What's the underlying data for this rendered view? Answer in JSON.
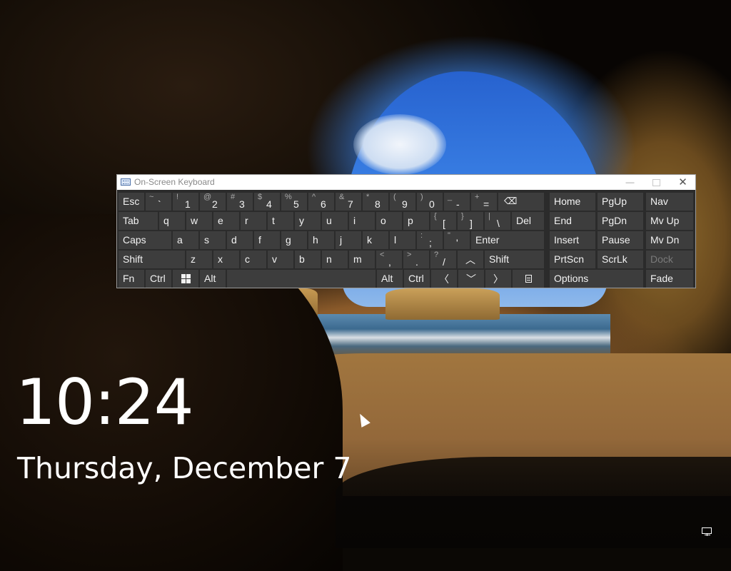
{
  "window": {
    "title": "On-Screen Keyboard",
    "minimize_glyph": "—",
    "close_glyph": "✕"
  },
  "keys": {
    "esc": "Esc",
    "grave": {
      "shift": "~",
      "main": "`"
    },
    "d1": {
      "shift": "!",
      "main": "1"
    },
    "d2": {
      "shift": "@",
      "main": "2"
    },
    "d3": {
      "shift": "#",
      "main": "3"
    },
    "d4": {
      "shift": "$",
      "main": "4"
    },
    "d5": {
      "shift": "%",
      "main": "5"
    },
    "d6": {
      "shift": "^",
      "main": "6"
    },
    "d7": {
      "shift": "&",
      "main": "7"
    },
    "d8": {
      "shift": "*",
      "main": "8"
    },
    "d9": {
      "shift": "(",
      "main": "9"
    },
    "d0": {
      "shift": ")",
      "main": "0"
    },
    "minus": {
      "shift": "_",
      "main": "-"
    },
    "equals": {
      "shift": "+",
      "main": "="
    },
    "backspace_glyph": "⌫",
    "tab": "Tab",
    "q": "q",
    "w": "w",
    "e": "e",
    "r": "r",
    "t": "t",
    "y": "y",
    "u": "u",
    "i": "i",
    "o": "o",
    "p": "p",
    "lbracket": {
      "shift": "{",
      "main": "["
    },
    "rbracket": {
      "shift": "}",
      "main": "]"
    },
    "backslash": {
      "shift": "|",
      "main": "\\"
    },
    "del": "Del",
    "caps": "Caps",
    "a": "a",
    "s": "s",
    "d": "d",
    "f": "f",
    "g": "g",
    "h": "h",
    "j": "j",
    "k": "k",
    "l": "l",
    "semicolon": {
      "shift": ":",
      "main": ";"
    },
    "quote": {
      "shift": "\"",
      "main": "'"
    },
    "enter": "Enter",
    "shift_left": "Shift",
    "z": "z",
    "x": "x",
    "c": "c",
    "v": "v",
    "b": "b",
    "n": "n",
    "m": "m",
    "comma": {
      "shift": "<",
      "main": ","
    },
    "period": {
      "shift": ">",
      "main": "."
    },
    "slash": {
      "shift": "?",
      "main": "/"
    },
    "up_glyph": "︿",
    "shift_right": "Shift",
    "fn": "Fn",
    "ctrl_left": "Ctrl",
    "alt_left": "Alt",
    "alt_right": "Alt",
    "ctrl_right": "Ctrl",
    "left_glyph": "〈",
    "down_glyph": "﹀",
    "right_glyph": "〉",
    "home": "Home",
    "pgup": "PgUp",
    "nav": "Nav",
    "end": "End",
    "pgdn": "PgDn",
    "mvup": "Mv Up",
    "insert": "Insert",
    "pause": "Pause",
    "mvdn": "Mv Dn",
    "prtscn": "PrtScn",
    "scrlk": "ScrLk",
    "dock": "Dock",
    "options": "Options",
    "fade": "Fade"
  },
  "lockscreen": {
    "time": "10:24",
    "date": "Thursday, December 7"
  }
}
